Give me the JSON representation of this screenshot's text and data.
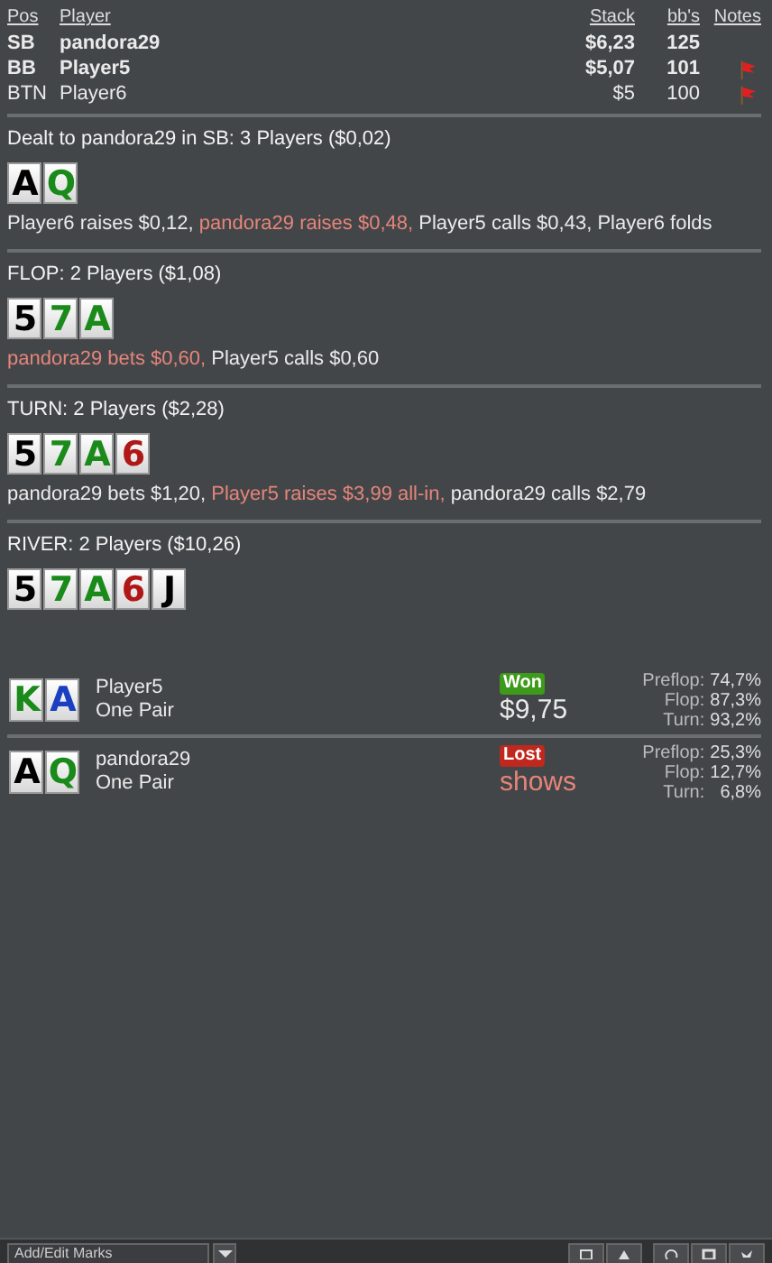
{
  "players_table": {
    "columns": [
      "Pos",
      "Player",
      "Stack",
      "bb's",
      "Notes"
    ],
    "rows": [
      {
        "pos": "SB",
        "player": "pandora29",
        "stack": "$6,23",
        "bbs": "125",
        "highlighted": true,
        "has_note": false
      },
      {
        "pos": "BB",
        "player": "Player5",
        "stack": "$5,07",
        "bbs": "101",
        "highlighted": true,
        "has_note": true
      },
      {
        "pos": "BTN",
        "player": "Player6",
        "stack": "$5",
        "bbs": "100",
        "highlighted": false,
        "has_note": true
      }
    ]
  },
  "streets": [
    {
      "title": "Dealt to pandora29 in SB: 3 Players ($0,02)",
      "cards": [
        {
          "rank": "A",
          "color": "#000000"
        },
        {
          "rank": "Q",
          "color": "#1a8a1a"
        }
      ],
      "actions": [
        {
          "text": "Player6 raises $0,12,",
          "highlight": false
        },
        {
          "text": "pandora29 raises $0,48,",
          "highlight": true
        },
        {
          "text": "Player5 calls $0,43,",
          "highlight": false
        },
        {
          "text": "Player6 folds",
          "highlight": false
        }
      ]
    },
    {
      "title": "FLOP: 2 Players ($1,08)",
      "cards": [
        {
          "rank": "5",
          "color": "#000000"
        },
        {
          "rank": "7",
          "color": "#1a8a1a"
        },
        {
          "rank": "A",
          "color": "#1a8a1a"
        }
      ],
      "actions": [
        {
          "text": "pandora29 bets $0,60,",
          "highlight": true
        },
        {
          "text": "Player5 calls $0,60",
          "highlight": false
        }
      ]
    },
    {
      "title": "TURN: 2 Players ($2,28)",
      "cards": [
        {
          "rank": "5",
          "color": "#000000"
        },
        {
          "rank": "7",
          "color": "#1a8a1a"
        },
        {
          "rank": "A",
          "color": "#1a8a1a"
        },
        {
          "rank": "6",
          "color": "#b01818"
        }
      ],
      "actions": [
        {
          "text": "pandora29 bets $1,20,",
          "highlight": false
        },
        {
          "text": "Player5 raises $3,99 all-in,",
          "highlight": true
        },
        {
          "text": "pandora29 calls $2,79",
          "highlight": false
        }
      ]
    },
    {
      "title": "RIVER: 2 Players ($10,26)",
      "cards": [
        {
          "rank": "5",
          "color": "#000000"
        },
        {
          "rank": "7",
          "color": "#1a8a1a"
        },
        {
          "rank": "A",
          "color": "#1a8a1a"
        },
        {
          "rank": "6",
          "color": "#b01818"
        },
        {
          "rank": "J",
          "color": "#000000"
        }
      ]
    }
  ],
  "results": [
    {
      "cards": [
        {
          "rank": "K",
          "color": "#1a8a1a"
        },
        {
          "rank": "A",
          "color": "#1a3fc0"
        }
      ],
      "player": "Player5",
      "hand": "One Pair",
      "kind": "won",
      "badge": "Won",
      "amount": "$9,75",
      "equity": [
        {
          "label": "Preflop:",
          "value": "74,7%"
        },
        {
          "label": "Flop:",
          "value": "87,3%"
        },
        {
          "label": "Turn:",
          "value": "93,2%"
        }
      ]
    },
    {
      "cards": [
        {
          "rank": "A",
          "color": "#000000"
        },
        {
          "rank": "Q",
          "color": "#1a8a1a"
        }
      ],
      "player": "pandora29",
      "hand": "One Pair",
      "kind": "lost",
      "badge": "Lost",
      "amount": "shows",
      "equity": [
        {
          "label": "Preflop:",
          "value": "25,3%"
        },
        {
          "label": "Flop:",
          "value": "12,7%"
        },
        {
          "label": "Turn:",
          "value": "6,8%"
        }
      ]
    }
  ],
  "toolbar": {
    "marks_dropdown": "Add/Edit Marks"
  }
}
